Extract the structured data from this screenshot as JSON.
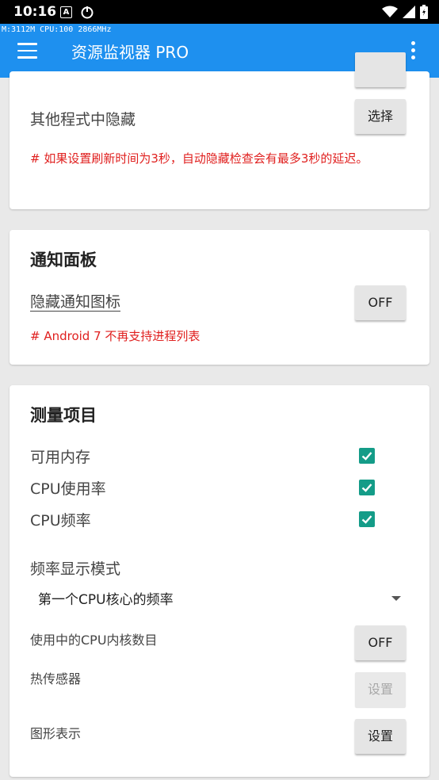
{
  "status_bar": {
    "time": "10:16",
    "notif_letter": "A"
  },
  "app_bar": {
    "overlay": "M:3112M CPU:100 2866MHz",
    "title": "资源监视器 PRO"
  },
  "card_hide": {
    "row_label": "其他程式中隐藏",
    "button": "选择",
    "note": "# 如果设置刷新时间为3秒，自动隐藏检查会有最多3秒的延迟。"
  },
  "card_notification": {
    "title": "通知面板",
    "row_label": "隐藏通知图标",
    "button": "OFF",
    "note": "# Android 7 不再支持进程列表"
  },
  "card_measure": {
    "title": "测量项目",
    "items": [
      {
        "label": "可用内存",
        "checked": true
      },
      {
        "label": "CPU使用率",
        "checked": true
      },
      {
        "label": "CPU频率",
        "checked": true
      }
    ],
    "freq_mode_label": "频率显示模式",
    "freq_mode_value": "第一个CPU核心的频率",
    "cores_label": "使用中的CPU内核数目",
    "cores_button": "OFF",
    "thermal_label": "热传感器",
    "thermal_button": "设置",
    "graph_label": "图形表示",
    "graph_button": "设置"
  },
  "colors": {
    "app_bar": "#1e90ef",
    "accent": "#149c88",
    "note": "#e0201f"
  }
}
